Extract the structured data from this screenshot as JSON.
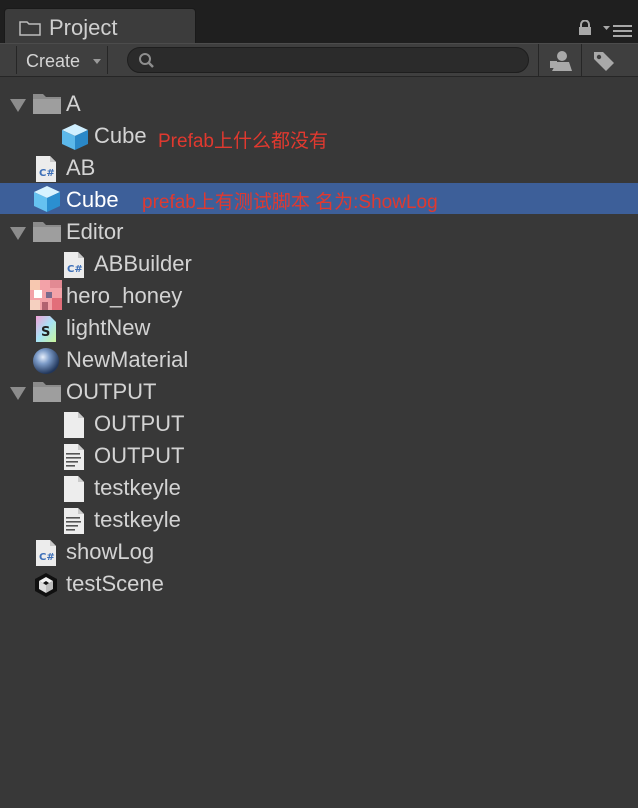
{
  "window": {
    "tab_title": "Project"
  },
  "toolbar": {
    "create_label": "Create",
    "search_value": "",
    "search_placeholder": ""
  },
  "tree": [
    {
      "name": "A",
      "icon": "folder-icon",
      "expanded": true
    },
    {
      "name": "Cube",
      "icon": "prefab-cube-icon"
    },
    {
      "name": "AB",
      "icon": "csharp-script-icon"
    },
    {
      "name": "Cube",
      "icon": "prefab-cube-icon",
      "selected": true
    },
    {
      "name": "Editor",
      "icon": "folder-icon",
      "expanded": true
    },
    {
      "name": "ABBuilder",
      "icon": "csharp-script-icon"
    },
    {
      "name": "hero_honey",
      "icon": "texture-icon"
    },
    {
      "name": "lightNew",
      "icon": "shader-icon"
    },
    {
      "name": "NewMaterial",
      "icon": "material-sphere-icon"
    },
    {
      "name": "OUTPUT",
      "icon": "folder-icon",
      "expanded": true
    },
    {
      "name": "OUTPUT",
      "icon": "blank-file-icon"
    },
    {
      "name": "OUTPUT",
      "icon": "text-document-icon"
    },
    {
      "name": "testkeyle",
      "icon": "blank-file-icon"
    },
    {
      "name": "testkeyle",
      "icon": "text-document-icon"
    },
    {
      "name": "showLog",
      "icon": "csharp-script-icon"
    },
    {
      "name": "testScene",
      "icon": "unity-scene-icon"
    }
  ],
  "annotations": {
    "cube_in_a": "Prefab上什么都没有",
    "cube_selected": "prefab上有测试脚本 名为:ShowLog"
  },
  "colors": {
    "background": "#383838",
    "selection": "#3d5f99",
    "annotation": "#e0392f"
  }
}
